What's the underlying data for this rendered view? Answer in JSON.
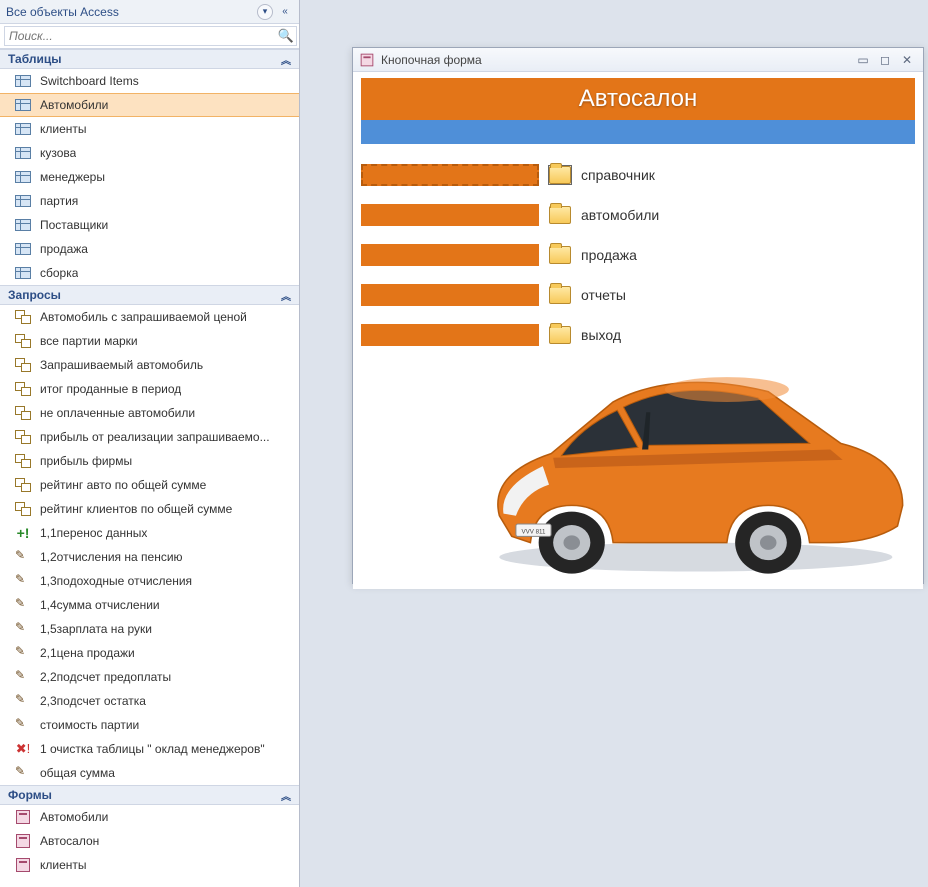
{
  "nav": {
    "title": "Все объекты Access",
    "search_placeholder": "Поиск...",
    "groups": [
      {
        "key": "tables",
        "label": "Таблицы",
        "items": [
          {
            "label": "Switchboard Items",
            "icon": "table"
          },
          {
            "label": "Автомобили",
            "icon": "table",
            "selected": true
          },
          {
            "label": "клиенты",
            "icon": "table"
          },
          {
            "label": "кузова",
            "icon": "table"
          },
          {
            "label": "менеджеры",
            "icon": "table"
          },
          {
            "label": "партия",
            "icon": "table"
          },
          {
            "label": "Поставщики",
            "icon": "table"
          },
          {
            "label": "продажа",
            "icon": "table"
          },
          {
            "label": "сборка",
            "icon": "table"
          }
        ]
      },
      {
        "key": "queries",
        "label": "Запросы",
        "items": [
          {
            "label": "Автомобиль с запрашиваемой ценой",
            "icon": "query"
          },
          {
            "label": "все партии марки",
            "icon": "query"
          },
          {
            "label": "Запрашиваемый автомобиль",
            "icon": "query"
          },
          {
            "label": "итог проданные в период",
            "icon": "query"
          },
          {
            "label": "не оплаченные автомобили",
            "icon": "query"
          },
          {
            "label": "прибыль от реализации запрашиваемо...",
            "icon": "query"
          },
          {
            "label": "прибыль фирмы",
            "icon": "query"
          },
          {
            "label": "рейтинг авто по общей сумме",
            "icon": "query"
          },
          {
            "label": "рейтинг клиентов по общей сумме",
            "icon": "query"
          },
          {
            "label": "1,1перенос данных",
            "icon": "append"
          },
          {
            "label": "1,2отчисления на пенсию",
            "icon": "update"
          },
          {
            "label": "1,3подоходные отчисления",
            "icon": "update"
          },
          {
            "label": "1,4сумма отчислении",
            "icon": "update"
          },
          {
            "label": "1,5зарплата на руки",
            "icon": "update"
          },
          {
            "label": "2,1цена продажи",
            "icon": "update"
          },
          {
            "label": "2,2подсчет предоплаты",
            "icon": "update"
          },
          {
            "label": "2,3подсчет остатка",
            "icon": "update"
          },
          {
            "label": "стоимость партии",
            "icon": "update"
          },
          {
            "label": "1 очистка таблицы \" оклад менеджеров\"",
            "icon": "delete"
          },
          {
            "label": "общая сумма",
            "icon": "update"
          }
        ]
      },
      {
        "key": "forms",
        "label": "Формы",
        "items": [
          {
            "label": "Автомобили",
            "icon": "form"
          },
          {
            "label": "Автосалон",
            "icon": "form"
          },
          {
            "label": "клиенты",
            "icon": "form"
          }
        ]
      }
    ]
  },
  "form_window": {
    "title": "Кнопочная форма",
    "banner": "Автосалон",
    "menu": [
      {
        "label": "справочник"
      },
      {
        "label": "автомобили"
      },
      {
        "label": "продажа"
      },
      {
        "label": "отчеты"
      },
      {
        "label": "выход"
      }
    ]
  },
  "colors": {
    "accent_orange": "#e37518",
    "stripe_blue": "#4f8fd8"
  }
}
